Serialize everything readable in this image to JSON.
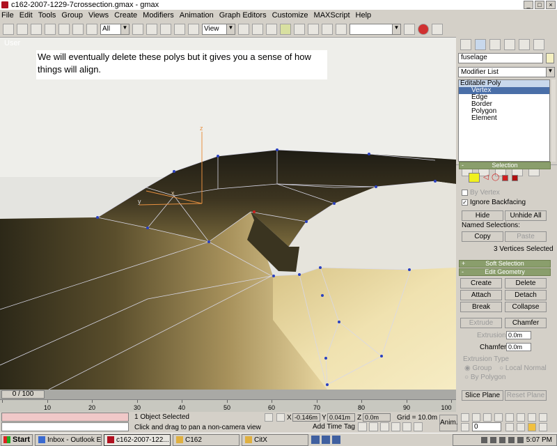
{
  "window": {
    "title": "c162-2007-1229-7crossection.gmax - gmax",
    "min": "_",
    "max": "□",
    "close": "×"
  },
  "menu": [
    "File",
    "Edit",
    "Tools",
    "Group",
    "Views",
    "Create",
    "Modifiers",
    "Animation",
    "Graph Editors",
    "Customize",
    "MAXScript",
    "Help"
  ],
  "toolbar": {
    "selection_filter": "All",
    "ref_coord": "View"
  },
  "viewport": {
    "label": "User",
    "note": "We will eventually delete these polys but it gives you a sense of how things will align.",
    "axis_x": "x",
    "axis_y": "y",
    "axis_z": "z"
  },
  "command_panel": {
    "object_name": "fuselage",
    "modifier_list": "Modifier List",
    "stack": {
      "root": "Editable Poly",
      "items": [
        "Vertex",
        "Edge",
        "Border",
        "Polygon",
        "Element"
      ],
      "selected": "Vertex"
    },
    "selection": {
      "header": "Selection",
      "by_vertex": "By Vertex",
      "ignore_backfacing": "Ignore Backfacing",
      "hide": "Hide",
      "unhide_all": "Unhide All",
      "named_selections": "Named Selections:",
      "copy": "Copy",
      "paste": "Paste",
      "status": "3 Vertices Selected"
    },
    "soft_selection": {
      "header": "Soft Selection"
    },
    "edit_geometry": {
      "header": "Edit Geometry",
      "create": "Create",
      "delete": "Delete",
      "attach": "Attach",
      "detach": "Detach",
      "break": "Break",
      "collapse": "Collapse",
      "extrude": "Extrude",
      "chamfer": "Chamfer",
      "extrusion_label": "Extrusion",
      "extrusion_value": "0.0m",
      "chamfer_label": "Chamfer",
      "chamfer_value": "0.0m",
      "extrusion_type": "Extrusion Type",
      "group": "Group",
      "local_normal": "Local Normal",
      "by_polygon": "By Polygon",
      "slice_plane": "Slice Plane",
      "reset_plane": "Reset Plane"
    }
  },
  "time_slider": {
    "position": "0 / 100",
    "ruler_labels": [
      "10",
      "20",
      "30",
      "40",
      "50",
      "60",
      "70",
      "80",
      "90",
      "100"
    ]
  },
  "status": {
    "objects_selected": "1 Object Selected",
    "prompt": "Click and drag to pan a non-camera view",
    "x_label": "X",
    "x_value": "-0.146m",
    "y_label": "Y",
    "y_value": "0.041m",
    "z_label": "Z",
    "z_value": "0.0m",
    "grid": "Grid = 10.0m",
    "add_time_tag": "Add Time Tag",
    "anim": "Anim.",
    "frame": "0"
  },
  "taskbar": {
    "start": "Start",
    "tasks": [
      "Inbox - Outlook E...",
      "c162-2007-122...",
      "C162",
      "CitX"
    ],
    "active_task": "c162-2007-122...",
    "clock": "5:07 PM"
  }
}
